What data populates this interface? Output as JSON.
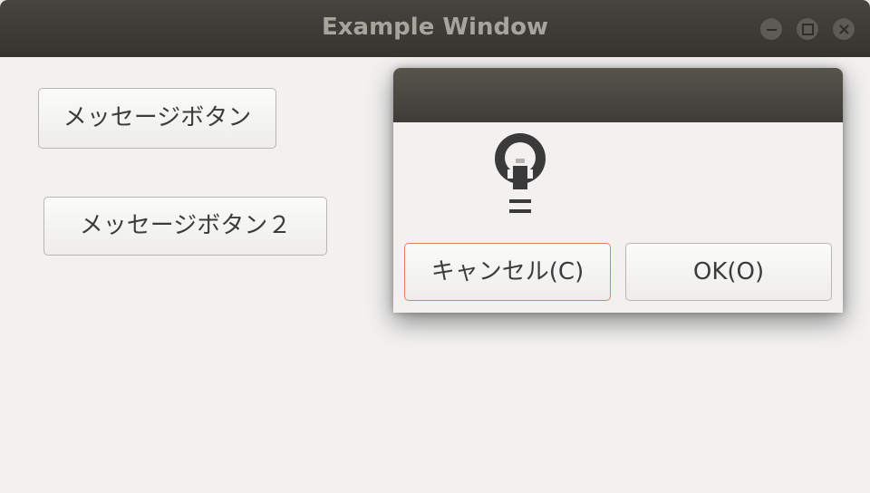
{
  "window": {
    "title": "Example Window"
  },
  "main": {
    "message_button_1": "メッセージボタン",
    "message_button_2": "メッセージボタン２"
  },
  "dialog": {
    "icon": "lightbulb-icon",
    "cancel_label": "キャンセル(C)",
    "ok_label": "OK(O)"
  },
  "colors": {
    "titlebar": "#3d3b36",
    "window_bg": "#f2f1f0",
    "focus_border": "#e0805e"
  }
}
